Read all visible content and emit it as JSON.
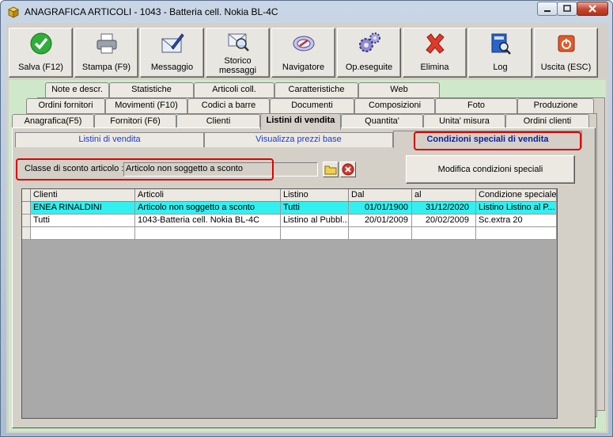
{
  "window": {
    "title": "ANAGRAFICA ARTICOLI - 1043 - Batteria cell. Nokia BL-4C"
  },
  "toolbar": [
    {
      "label": "Salva (F12)",
      "icon": "check-icon"
    },
    {
      "label": "Stampa (F9)",
      "icon": "printer-icon"
    },
    {
      "label": "Messaggio",
      "icon": "envelope-pen-icon"
    },
    {
      "label": "Storico messaggi",
      "icon": "mail-search-icon"
    },
    {
      "label": "Navigatore",
      "icon": "compass-icon"
    },
    {
      "label": "Op.eseguite",
      "icon": "gears-icon"
    },
    {
      "label": "Elimina",
      "icon": "red-x-icon"
    },
    {
      "label": "Log",
      "icon": "book-search-icon"
    },
    {
      "label": "Uscita (ESC)",
      "icon": "exit-icon"
    }
  ],
  "tabs": {
    "row1": [
      "Note e descr.",
      "Statistiche",
      "Articoli coll.",
      "Caratteristiche",
      "Web"
    ],
    "row2": [
      "Ordini fornitori",
      "Movimenti (F10)",
      "Codici a barre",
      "Documenti",
      "Composizioni",
      "Foto",
      "Produzione"
    ],
    "row3": [
      "Anagrafica(F5)",
      "Fornitori (F6)",
      "Clienti",
      "Listini di vendita",
      "Quantita'",
      "Unita' misura",
      "Ordini clienti"
    ],
    "active": "Listini di vendita"
  },
  "subtabs": [
    "Listini di vendita",
    "Visualizza prezzi base",
    "Condizioni speciali di vendita"
  ],
  "discount": {
    "label": "Classe di sconto articolo :",
    "value": "Articolo non soggetto a sconto"
  },
  "modify_button": "Modifica condizioni speciali",
  "grid": {
    "columns": [
      "Clienti",
      "Articoli",
      "Listino",
      "Dal",
      "al",
      "Condizione speciale"
    ],
    "rows": [
      [
        "ENEA RINALDINI",
        "Articolo non soggetto a sconto",
        "Tutti",
        "01/01/1900",
        "31/12/2020",
        "Listino Listino al P..."
      ],
      [
        "Tutti",
        "1043-Batteria cell. Nokia BL-4C",
        "Listino al Pubbl...",
        "20/01/2009",
        "20/02/2009",
        "Sc.extra 20"
      ],
      [
        "",
        "",
        "",
        "",
        "",
        ""
      ]
    ]
  },
  "colors": {
    "selected_row": "#33f0f0",
    "highlight": "#e00000",
    "subtab_text": "#1a3bd0"
  }
}
